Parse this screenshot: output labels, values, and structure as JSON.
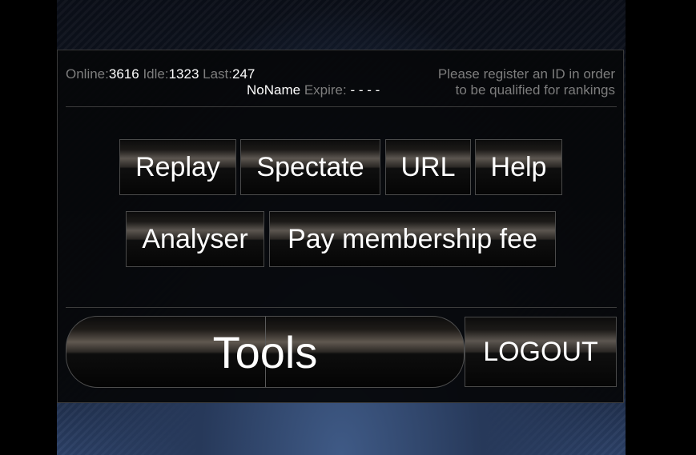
{
  "stats": {
    "online_label": "Online:",
    "online_value": "3616",
    "idle_label": "Idle:",
    "idle_value": "1323",
    "last_label": "Last:",
    "last_value": "247"
  },
  "account": {
    "name": "NoName",
    "expire_label": "Expire:",
    "expire_value": "- - - -"
  },
  "notice": {
    "line1": "Please register an ID in order",
    "line2": "to be qualified for rankings"
  },
  "menu": {
    "replay": "Replay",
    "spectate": "Spectate",
    "url": "URL",
    "help": "Help",
    "analyser": "Analyser",
    "pay_fee": "Pay membership fee"
  },
  "footer": {
    "tools": "Tools",
    "logout": "LOGOUT"
  }
}
